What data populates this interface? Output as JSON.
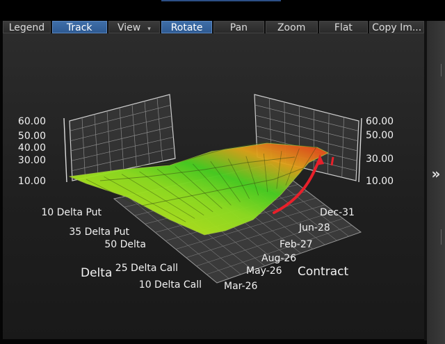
{
  "toolbar": {
    "buttons": [
      {
        "label": "Legend",
        "active": false
      },
      {
        "label": "Track",
        "active": true
      },
      {
        "label": "View",
        "active": false,
        "dropdown": true
      },
      {
        "label": "Rotate",
        "active": true
      },
      {
        "label": "Pan",
        "active": false
      },
      {
        "label": "Zoom",
        "active": false
      },
      {
        "label": "Flat",
        "active": false
      },
      {
        "label": "Copy Im...",
        "active": false
      }
    ]
  },
  "side_panel": {
    "expand_glyph": "»"
  },
  "chart_data": {
    "type": "surface",
    "z_axis_left_ticks": [
      "60.00",
      "50.00",
      "40.00",
      "30.00",
      "10.00"
    ],
    "z_axis_right_ticks": [
      "60.00",
      "50.00",
      "30.00",
      "10.00"
    ],
    "delta_axis": {
      "label": "Delta",
      "ticks": [
        "10 Delta Put",
        "35 Delta Put",
        "50 Delta",
        "25 Delta Call",
        "10 Delta Call"
      ]
    },
    "contract_axis": {
      "label": "Contract",
      "ticks": [
        "Dec-31",
        "Jun-28",
        "Feb-27",
        "Aug-26",
        "May-26",
        "Mar-26"
      ]
    },
    "colors": {
      "low": "#c9e81c",
      "mid": "#3fcf24",
      "high": "#e8321c",
      "annotation_arrow": "#e8202a"
    }
  }
}
